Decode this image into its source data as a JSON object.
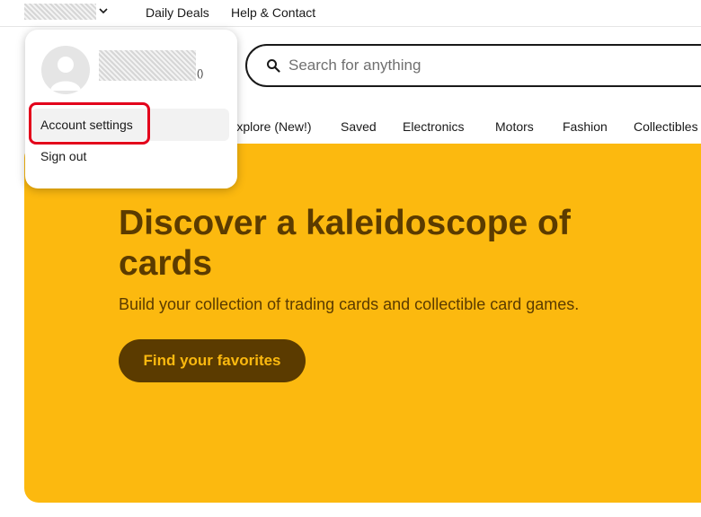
{
  "header": {
    "links": [
      "Daily Deals",
      "Help & Contact"
    ]
  },
  "search": {
    "placeholder": "Search for anything"
  },
  "nav": {
    "categories": [
      "Explore (New!)",
      "Saved",
      "Electronics",
      "Motors",
      "Fashion",
      "Collectibles"
    ]
  },
  "hero": {
    "title": "Discover a kaleidoscope of cards",
    "subtitle": "Build your collection of trading cards and collectible card games.",
    "cta": "Find your favorites"
  },
  "account_menu": {
    "feedback_count": "()",
    "items": [
      "Account settings",
      "Sign out"
    ]
  },
  "colors": {
    "hero_background": "#fcb90f",
    "hero_text": "#5b3b00",
    "highlight": "#e3001b"
  },
  "icons": [
    "chevron-down-icon",
    "search-icon",
    "avatar-placeholder-icon"
  ]
}
